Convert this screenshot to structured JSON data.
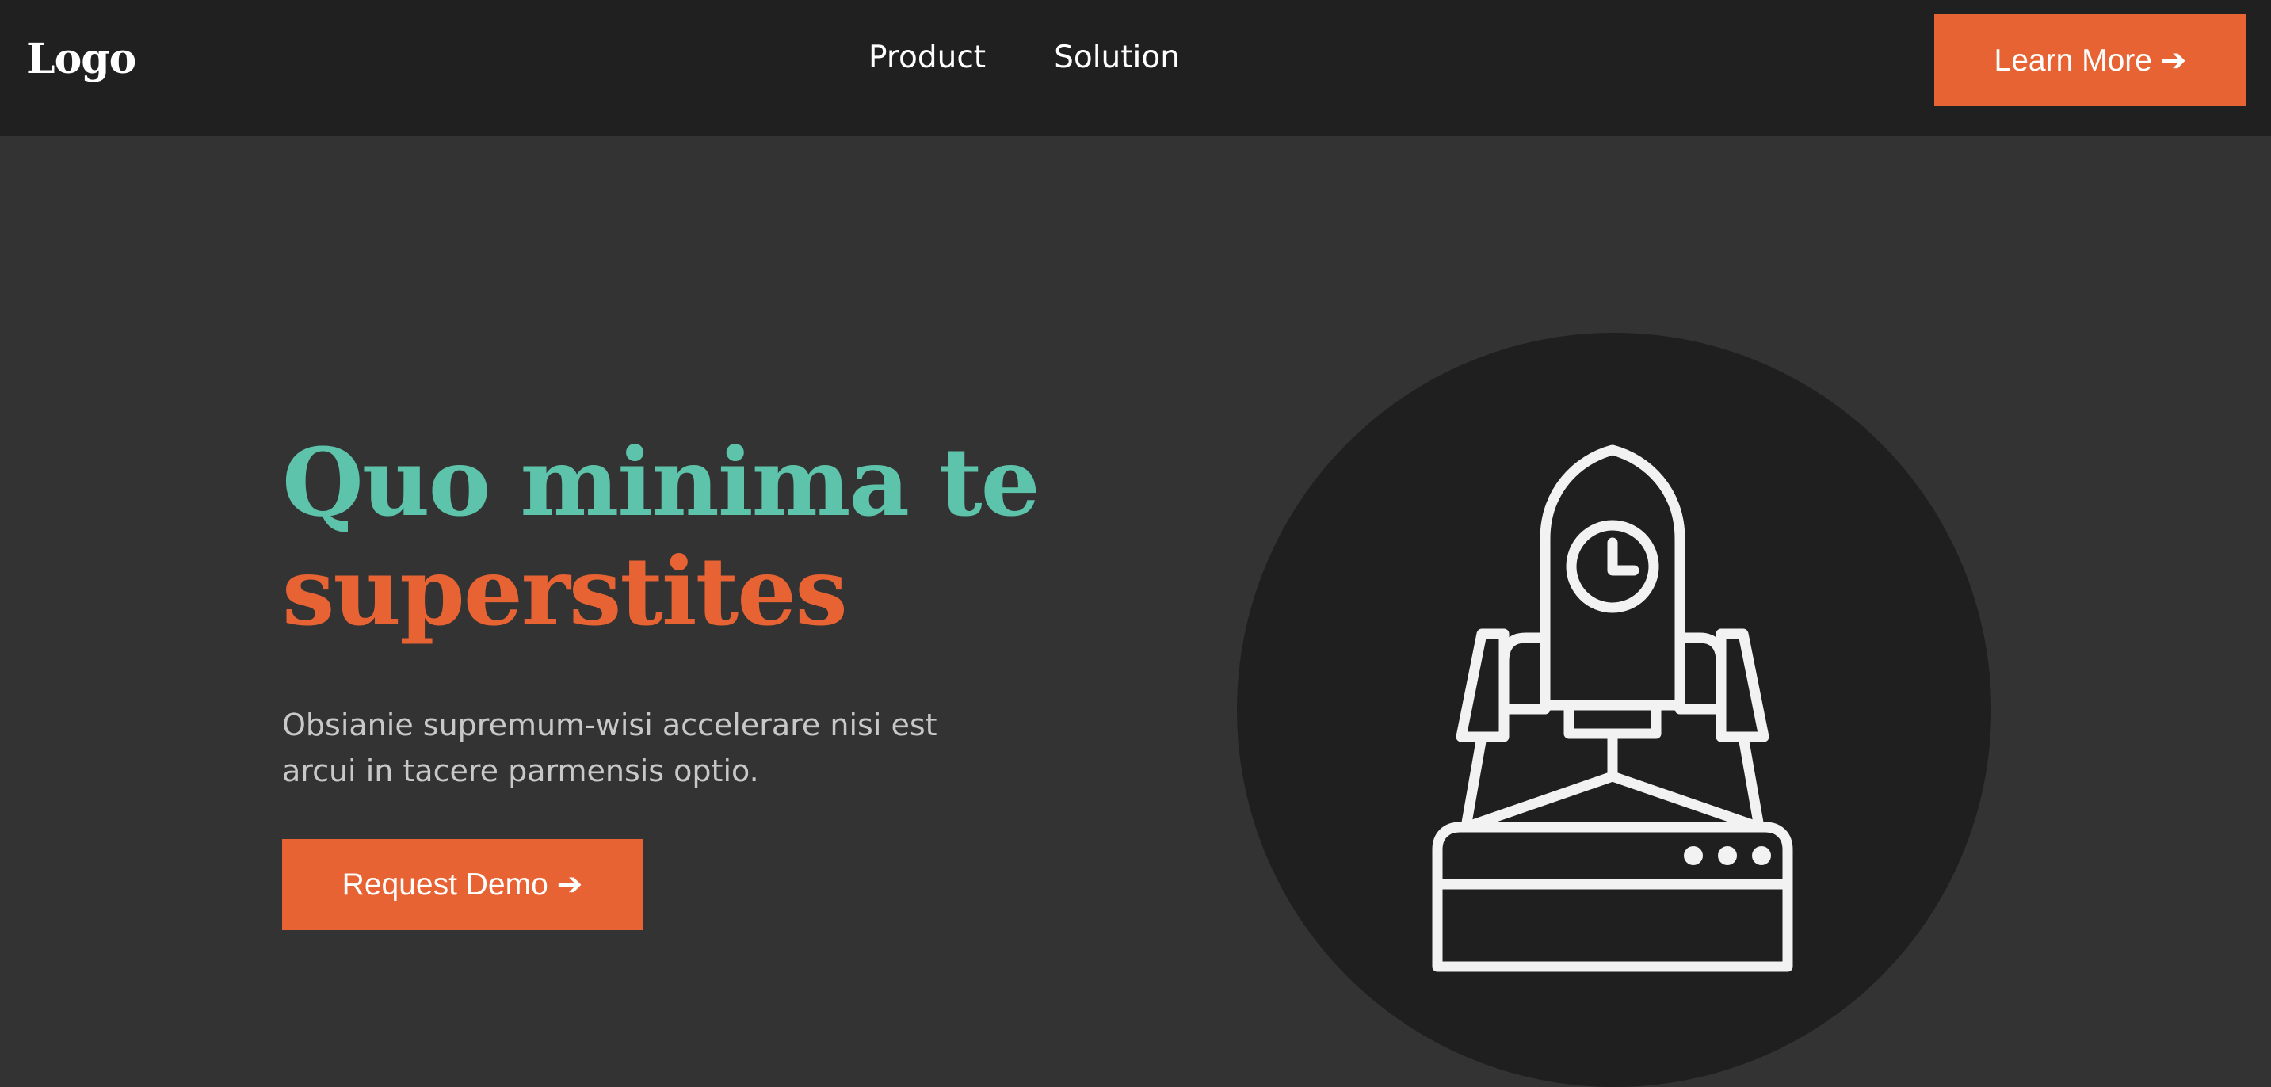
{
  "navbar": {
    "logo": "Logo",
    "links": [
      "Product",
      "Solution"
    ],
    "cta_label": "Learn More ➔"
  },
  "hero": {
    "title_line1": "Quo minima te",
    "title_line2": "superstites",
    "subtitle_line1": "Obsianie supremum-wisi accelerare nisi est",
    "subtitle_line2": "arcui in tacere parmensis optio.",
    "cta_label": "Request Demo ➔",
    "illustration_icon": "rocket-launch-icon"
  },
  "colors": {
    "navbar_bg": "#202020",
    "page_bg": "#333333",
    "accent_orange": "#e86333",
    "accent_teal": "#5dc3aa",
    "circle_bg": "#1f1f1f"
  }
}
